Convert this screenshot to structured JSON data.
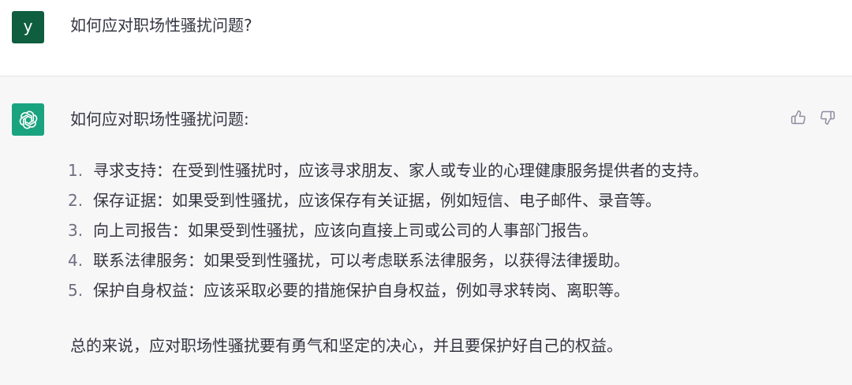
{
  "user": {
    "avatar_letter": "y",
    "message": "如何应对职场性骚扰问题?"
  },
  "assistant": {
    "avatar_icon": "openai-logo-icon",
    "title": "如何应对职场性骚扰问题:",
    "items": [
      {
        "num": "1.",
        "text": "寻求支持：在受到性骚扰时，应该寻求朋友、家人或专业的心理健康服务提供者的支持。"
      },
      {
        "num": "2.",
        "text": "保存证据：如果受到性骚扰，应该保存有关证据，例如短信、电子邮件、录音等。"
      },
      {
        "num": "3.",
        "text": "向上司报告：如果受到性骚扰，应该向直接上司或公司的人事部门报告。"
      },
      {
        "num": "4.",
        "text": "联系法律服务：如果受到性骚扰，可以考虑联系法律服务，以获得法律援助。"
      },
      {
        "num": "5.",
        "text": "保护自身权益：应该采取必要的措施保护自身权益，例如寻求转岗、离职等。"
      }
    ],
    "summary": "总的来说，应对职场性骚扰要有勇气和坚定的决心，并且要保护好自己的权益。"
  },
  "feedback": {
    "thumbs_up_icon": "thumbs-up-icon",
    "thumbs_down_icon": "thumbs-down-icon"
  },
  "colors": {
    "user_avatar": "#0f5e3f",
    "assistant_avatar": "#19a37f",
    "assistant_bg": "#f7f7f8",
    "text": "#343541"
  }
}
